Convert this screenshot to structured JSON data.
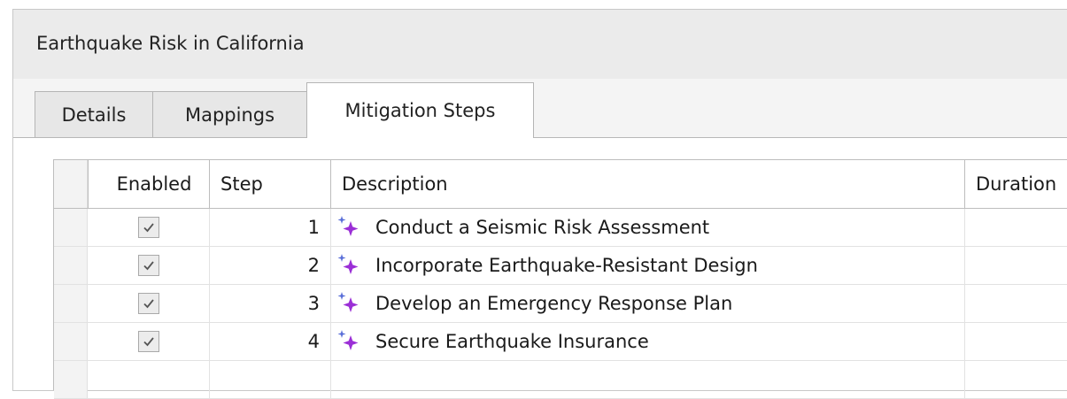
{
  "window": {
    "title": "Earthquake Risk in California"
  },
  "tabs": [
    {
      "label": "Details",
      "active": false
    },
    {
      "label": "Mappings",
      "active": false
    },
    {
      "label": "Mitigation Steps",
      "active": true
    }
  ],
  "grid": {
    "columns": [
      "Enabled",
      "Step",
      "Description",
      "Duration"
    ],
    "rows": [
      {
        "enabled": true,
        "step": "1",
        "icon": "sparkle-icon",
        "description": "Conduct a Seismic Risk Assessment",
        "duration": ""
      },
      {
        "enabled": true,
        "step": "2",
        "icon": "sparkle-icon",
        "description": "Incorporate Earthquake-Resistant Design",
        "duration": ""
      },
      {
        "enabled": true,
        "step": "3",
        "icon": "sparkle-icon",
        "description": "Develop an Emergency Response Plan",
        "duration": ""
      },
      {
        "enabled": true,
        "step": "4",
        "icon": "sparkle-icon",
        "description": "Secure Earthquake Insurance",
        "duration": ""
      }
    ]
  },
  "colors": {
    "sparkle": "#9b2fd6",
    "sparkle_small": "#5a6fd8"
  }
}
